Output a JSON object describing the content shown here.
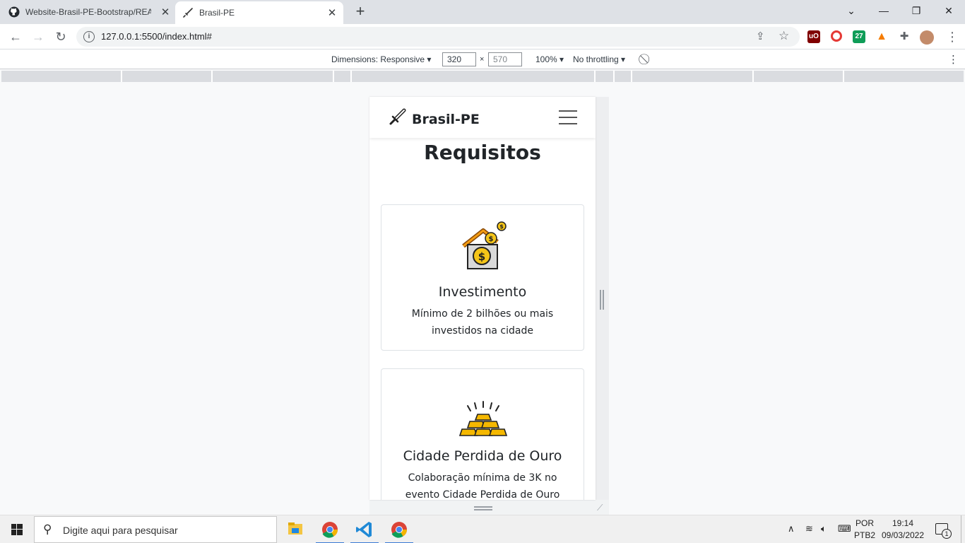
{
  "browser": {
    "tabs": [
      {
        "title": "Website-Brasil-PE-Bootstrap/README.md",
        "icon": "github-icon",
        "active": false
      },
      {
        "title": "Brasil-PE",
        "icon": "sword-icon",
        "active": true
      }
    ],
    "address": "127.0.0.1:5500/index.html#",
    "extensions": [
      "ublock-icon",
      "opera-addon-icon",
      "calendar-27-icon",
      "vlc-icon",
      "puzzle-extensions-icon",
      "profile-avatar"
    ]
  },
  "devtools": {
    "dimensions_label": "Dimensions: Responsive",
    "width": "320",
    "height": "570",
    "times": "×",
    "zoom": "100%",
    "throttle": "No throttling"
  },
  "site": {
    "brand": "Brasil-PE",
    "section_title": "Requisitos",
    "cards": [
      {
        "title": "Investimento",
        "text": "Mínimo de 2 bilhões ou mais investidos na cidade",
        "icon": "house-money-icon"
      },
      {
        "title": "Cidade Perdida de Ouro",
        "text": "Colaboração mínima de 3K no evento Cidade Perdida de Ouro",
        "icon": "gold-bars-icon"
      }
    ]
  },
  "taskbar": {
    "search_placeholder": "Digite aqui para pesquisar",
    "lang_top": "POR",
    "lang_bottom": "PTB2",
    "time": "19:14",
    "date": "09/03/2022",
    "notifications": "1"
  }
}
